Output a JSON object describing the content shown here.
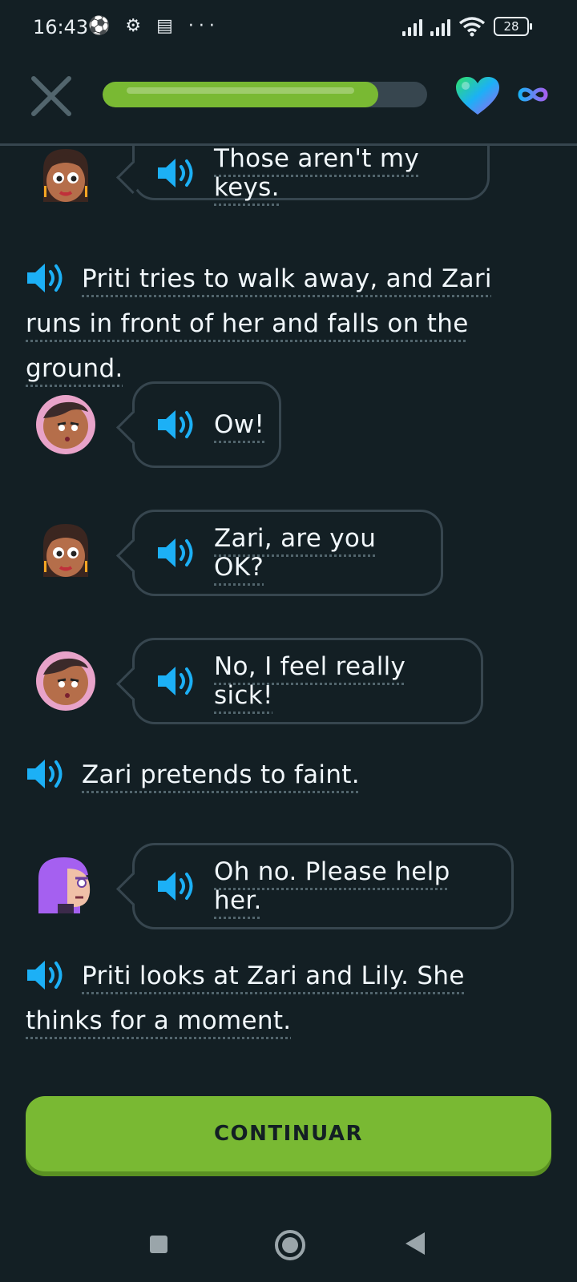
{
  "status_bar": {
    "time": "16:43",
    "status_icons": "⚽ ⚙ ▤ ···",
    "battery": "28"
  },
  "header": {
    "progress_percent": 85
  },
  "colors": {
    "background": "#131f24",
    "accent_green": "#79b933",
    "speaker_blue": "#1cb0f6",
    "border": "#37464f"
  },
  "story": {
    "line1": "Those aren't my keys.",
    "narration1": "Priti tries to walk away, and Zari runs in front of her and falls on the ground.",
    "line2": "Ow!",
    "line3": "Zari, are you OK?",
    "line4": "No, I feel really sick!",
    "narration2": "Zari pretends to faint.",
    "line5": "Oh no. Please help her.",
    "narration3": "Priti looks at Zari and Lily. She thinks for a moment."
  },
  "continue_label": "CONTINUAR"
}
